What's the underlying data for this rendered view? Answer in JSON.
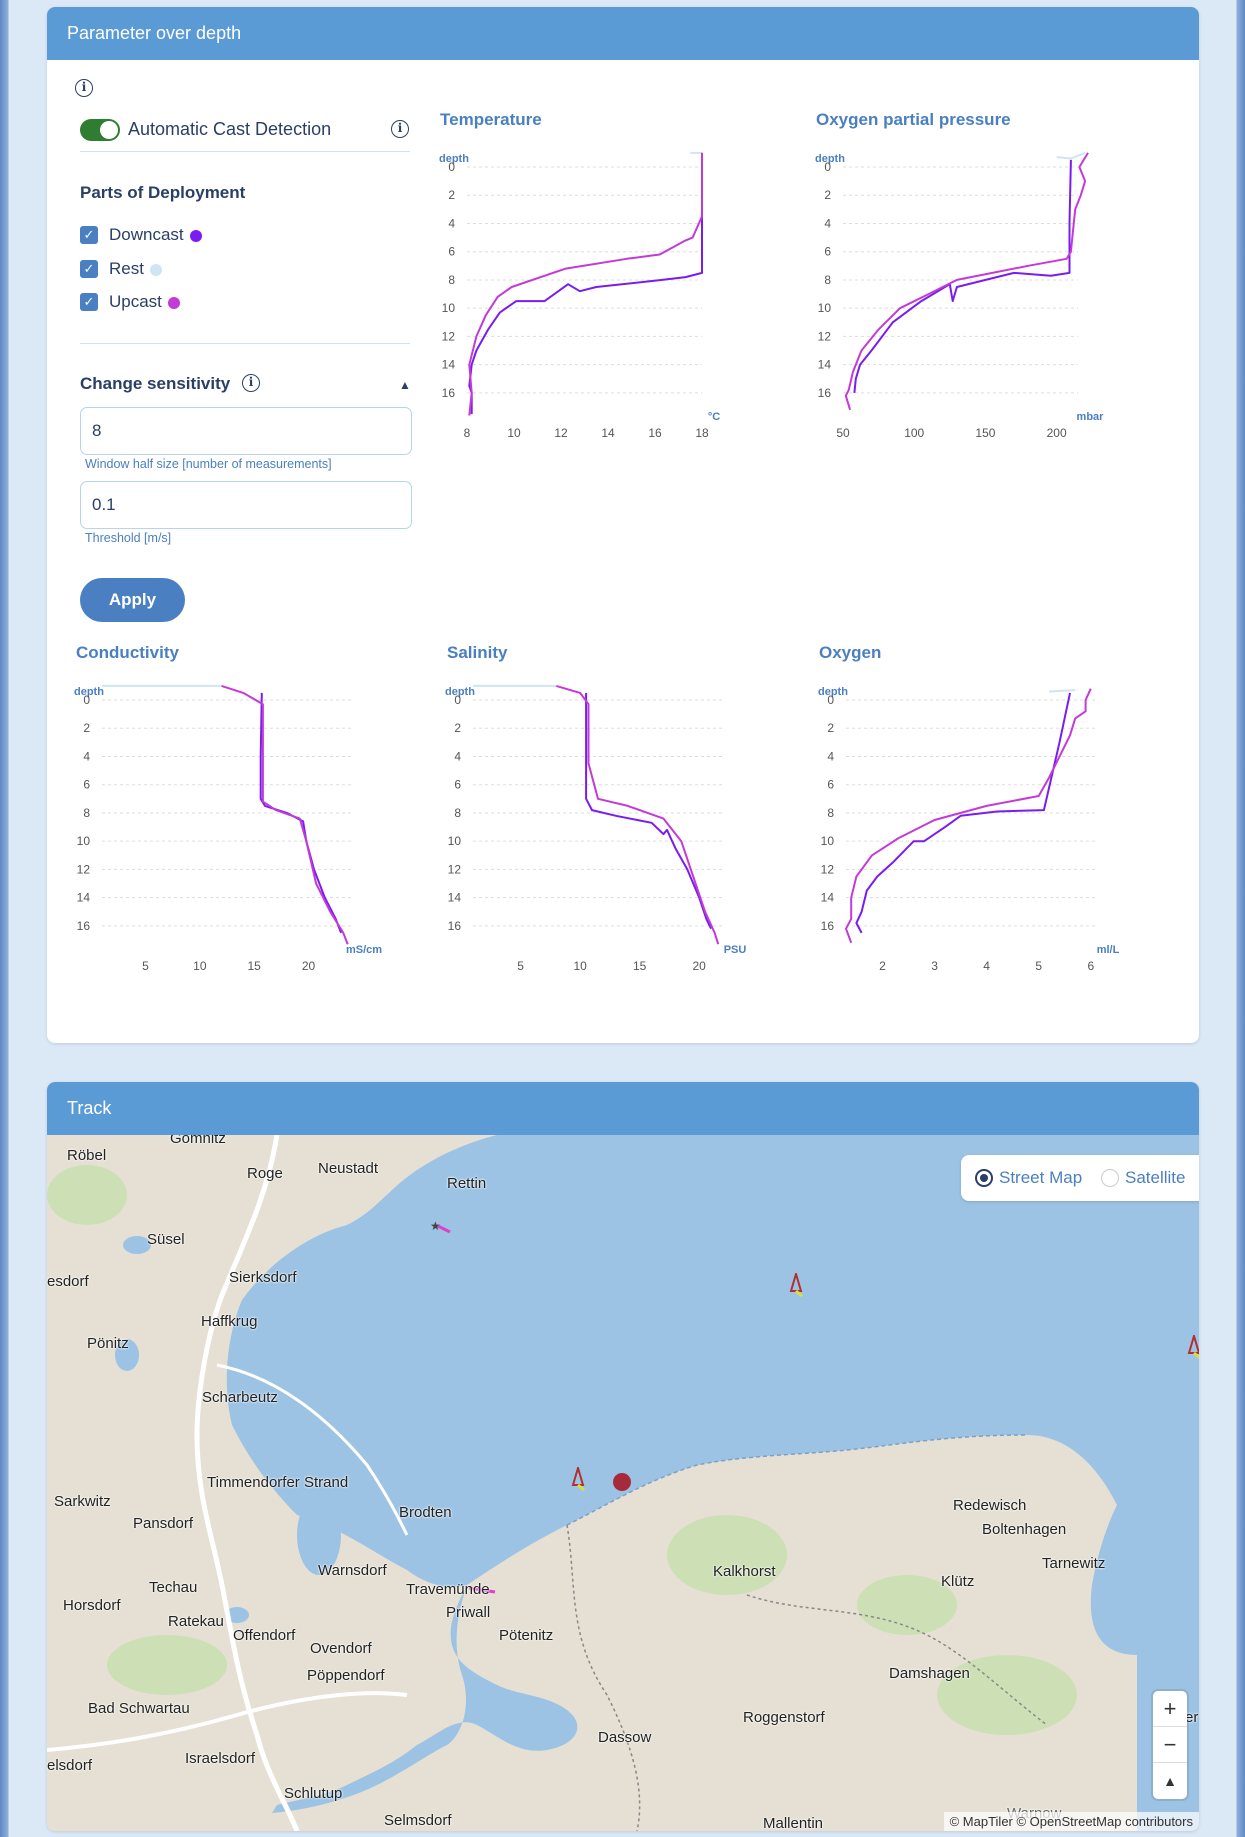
{
  "params_card": {
    "title": "Parameter over depth",
    "info_glyph": "i",
    "toggle_label": "Automatic Cast Detection",
    "toggle_on": true,
    "parts_title": "Parts of Deployment",
    "parts": [
      {
        "label": "Downcast",
        "checked": true,
        "color": "#7a1cf0"
      },
      {
        "label": "Rest",
        "checked": true,
        "color": "#cfe5f4"
      },
      {
        "label": "Upcast",
        "checked": true,
        "color": "#c33ad8"
      }
    ],
    "sensitivity_title": "Change sensitivity",
    "window_value": "8",
    "window_hint": "Window half size [number of measurements]",
    "threshold_value": "0.1",
    "threshold_hint": "Threshold [m/s]",
    "apply_label": "Apply"
  },
  "chart_data": [
    {
      "id": "temperature",
      "type": "line",
      "title": "Temperature",
      "ylabel": "depth",
      "xlabel": "°C",
      "xlim": [
        8,
        18
      ],
      "ylim": [
        0,
        17
      ],
      "xticks": [
        8,
        10,
        12,
        14,
        16,
        18
      ],
      "yticks": [
        0,
        2,
        4,
        6,
        8,
        10,
        12,
        14,
        16
      ],
      "y_inverted": true,
      "grid": true,
      "series": [
        {
          "part": "Rest",
          "color": "#cfe5f4",
          "points": [
            [
              17.5,
              -1
            ],
            [
              18,
              -1
            ]
          ]
        },
        {
          "part": "Downcast",
          "color": "#7a1cf0",
          "points": [
            [
              18,
              -1
            ],
            [
              18,
              2
            ],
            [
              18,
              7.5
            ],
            [
              17.3,
              7.8
            ],
            [
              16.3,
              8
            ],
            [
              13.5,
              8.5
            ],
            [
              12.8,
              8.8
            ],
            [
              12.3,
              8.3
            ],
            [
              11.3,
              9.5
            ],
            [
              10.1,
              9.5
            ],
            [
              9.4,
              10.3
            ],
            [
              8.9,
              11.5
            ],
            [
              8.4,
              13
            ],
            [
              8.2,
              14
            ],
            [
              8.1,
              15.5
            ],
            [
              8.2,
              16
            ],
            [
              8.2,
              17.5
            ]
          ]
        },
        {
          "part": "Upcast",
          "color": "#c33ad8",
          "points": [
            [
              18,
              -1
            ],
            [
              18,
              3.5
            ],
            [
              17.6,
              5
            ],
            [
              17.3,
              5.2
            ],
            [
              16.2,
              6.2
            ],
            [
              14.8,
              6.5
            ],
            [
              12.2,
              7.2
            ],
            [
              9.9,
              8.5
            ],
            [
              9.3,
              9.2
            ],
            [
              8.8,
              10.5
            ],
            [
              8.4,
              12
            ],
            [
              8.1,
              14
            ],
            [
              8.2,
              16
            ],
            [
              8.1,
              17.6
            ]
          ]
        }
      ]
    },
    {
      "id": "oxygen-partial-pressure",
      "type": "line",
      "title": "Oxygen partial pressure",
      "ylabel": "depth",
      "xlabel": "mbar",
      "xlim": [
        50,
        215
      ],
      "ylim": [
        0,
        17
      ],
      "xticks": [
        50,
        100,
        150,
        200
      ],
      "yticks": [
        0,
        2,
        4,
        6,
        8,
        10,
        12,
        14,
        16
      ],
      "y_inverted": true,
      "grid": true,
      "series": [
        {
          "part": "Rest",
          "color": "#cfe5f4",
          "points": [
            [
              200,
              -0.7
            ],
            [
              210,
              -0.6
            ],
            [
              220,
              -1
            ]
          ]
        },
        {
          "part": "Downcast",
          "color": "#7a1cf0",
          "points": [
            [
              210,
              -0.5
            ],
            [
              209,
              4
            ],
            [
              209,
              7.5
            ],
            [
              196,
              7.7
            ],
            [
              170,
              7.5
            ],
            [
              130,
              8.5
            ],
            [
              127,
              9.5
            ],
            [
              125,
              8.3
            ],
            [
              105,
              9.5
            ],
            [
              85,
              11
            ],
            [
              70,
              13
            ],
            [
              62,
              14
            ],
            [
              59,
              15
            ],
            [
              58,
              16
            ]
          ]
        },
        {
          "part": "Upcast",
          "color": "#c33ad8",
          "points": [
            [
              222,
              -1
            ],
            [
              216,
              0
            ],
            [
              220,
              1
            ],
            [
              217,
              2
            ],
            [
              213,
              3
            ],
            [
              211,
              5
            ],
            [
              210,
              6
            ],
            [
              207,
              6.5
            ],
            [
              180,
              7
            ],
            [
              130,
              8
            ],
            [
              110,
              9
            ],
            [
              90,
              10
            ],
            [
              75,
              11.5
            ],
            [
              63,
              13
            ],
            [
              57,
              14.5
            ],
            [
              54,
              15.8
            ],
            [
              52,
              16.2
            ],
            [
              55,
              17.2
            ]
          ]
        }
      ]
    },
    {
      "id": "conductivity",
      "type": "line",
      "title": "Conductivity",
      "ylabel": "depth",
      "xlabel": "mS/cm",
      "xlim": [
        1,
        24
      ],
      "ylim": [
        0,
        17
      ],
      "xticks": [
        5,
        10,
        15,
        20
      ],
      "yticks": [
        0,
        2,
        4,
        6,
        8,
        10,
        12,
        14,
        16
      ],
      "y_inverted": true,
      "grid": true,
      "series": [
        {
          "part": "Rest",
          "color": "#cfe5f4",
          "points": [
            [
              1,
              -1
            ],
            [
              12,
              -1
            ]
          ]
        },
        {
          "part": "Downcast",
          "color": "#7a1cf0",
          "points": [
            [
              15.7,
              -0.5
            ],
            [
              15.6,
              4
            ],
            [
              15.6,
              7
            ],
            [
              16,
              7.5
            ],
            [
              18,
              8
            ],
            [
              19.5,
              8.6
            ],
            [
              19.8,
              10
            ],
            [
              20.5,
              12
            ],
            [
              21.5,
              14
            ],
            [
              22.5,
              15.5
            ],
            [
              23,
              16.5
            ]
          ]
        },
        {
          "part": "Upcast",
          "color": "#c33ad8",
          "points": [
            [
              12,
              -1
            ],
            [
              14,
              -0.5
            ],
            [
              15.8,
              0.3
            ],
            [
              15.8,
              4
            ],
            [
              15.8,
              7.2
            ],
            [
              17,
              7.8
            ],
            [
              19.2,
              8.4
            ],
            [
              19.8,
              10
            ],
            [
              20.7,
              13
            ],
            [
              22,
              15
            ],
            [
              23.2,
              16.5
            ],
            [
              23.6,
              17.3
            ]
          ]
        }
      ]
    },
    {
      "id": "salinity",
      "type": "line",
      "title": "Salinity",
      "ylabel": "depth",
      "xlabel": "PSU",
      "xlim": [
        1,
        22
      ],
      "ylim": [
        0,
        17
      ],
      "xticks": [
        5,
        10,
        15,
        20
      ],
      "yticks": [
        0,
        2,
        4,
        6,
        8,
        10,
        12,
        14,
        16
      ],
      "y_inverted": true,
      "grid": true,
      "series": [
        {
          "part": "Rest",
          "color": "#cfe5f4",
          "points": [
            [
              1,
              -1
            ],
            [
              8,
              -1
            ]
          ]
        },
        {
          "part": "Downcast",
          "color": "#7a1cf0",
          "points": [
            [
              10.5,
              -0.5
            ],
            [
              10.5,
              4
            ],
            [
              10.5,
              7
            ],
            [
              11,
              7.8
            ],
            [
              13,
              8.2
            ],
            [
              16,
              8.7
            ],
            [
              17,
              9.5
            ],
            [
              17.3,
              9.2
            ],
            [
              18,
              10.5
            ],
            [
              19,
              12
            ],
            [
              20,
              14
            ],
            [
              20.6,
              15.5
            ],
            [
              21,
              16.2
            ]
          ]
        },
        {
          "part": "Upcast",
          "color": "#c33ad8",
          "points": [
            [
              8,
              -1
            ],
            [
              10,
              -0.5
            ],
            [
              10.7,
              0.3
            ],
            [
              10.7,
              4.5
            ],
            [
              11.5,
              7
            ],
            [
              14,
              7.5
            ],
            [
              17,
              8.4
            ],
            [
              18.5,
              10
            ],
            [
              19.5,
              12.5
            ],
            [
              20.5,
              15
            ],
            [
              21.3,
              16.5
            ],
            [
              21.6,
              17.3
            ]
          ]
        }
      ]
    },
    {
      "id": "oxygen",
      "type": "line",
      "title": "Oxygen",
      "ylabel": "depth",
      "xlabel": "ml/L",
      "xlim": [
        1.3,
        6.1
      ],
      "ylim": [
        0,
        17
      ],
      "xticks": [
        2,
        3,
        4,
        5,
        6
      ],
      "yticks": [
        0,
        2,
        4,
        6,
        8,
        10,
        12,
        14,
        16
      ],
      "y_inverted": true,
      "grid": true,
      "series": [
        {
          "part": "Rest",
          "color": "#cfe5f4",
          "points": [
            [
              5.2,
              -0.6
            ],
            [
              5.7,
              -0.7
            ]
          ]
        },
        {
          "part": "Downcast",
          "color": "#7a1cf0",
          "points": [
            [
              5.6,
              -0.5
            ],
            [
              5.4,
              3
            ],
            [
              5.1,
              7.8
            ],
            [
              4.2,
              7.9
            ],
            [
              3.5,
              8.2
            ],
            [
              3.2,
              9
            ],
            [
              2.8,
              10
            ],
            [
              2.6,
              10
            ],
            [
              2.2,
              11.5
            ],
            [
              1.9,
              12.5
            ],
            [
              1.7,
              13.5
            ],
            [
              1.6,
              15
            ],
            [
              1.5,
              15.8
            ],
            [
              1.6,
              16.5
            ]
          ]
        },
        {
          "part": "Upcast",
          "color": "#c33ad8",
          "points": [
            [
              6,
              -0.8
            ],
            [
              5.9,
              0
            ],
            [
              5.9,
              0.8
            ],
            [
              5.7,
              1.3
            ],
            [
              5.6,
              2.5
            ],
            [
              5.2,
              5.5
            ],
            [
              5,
              6.8
            ],
            [
              4,
              7.5
            ],
            [
              3,
              8.5
            ],
            [
              2.3,
              9.8
            ],
            [
              1.8,
              11
            ],
            [
              1.5,
              12.5
            ],
            [
              1.4,
              14
            ],
            [
              1.4,
              15.5
            ],
            [
              1.3,
              16.2
            ],
            [
              1.4,
              17.2
            ]
          ]
        }
      ]
    }
  ],
  "track_card": {
    "title": "Track",
    "layers": [
      {
        "label": "Street Map",
        "selected": true
      },
      {
        "label": "Satellite",
        "selected": false
      }
    ],
    "zoom_in": "+",
    "zoom_out": "−",
    "compass": "▲",
    "attribution": "© MapTiler © OpenStreetMap contributors",
    "places": [
      "Gömnitz",
      "Röbel",
      "Roge",
      "Neustadt",
      "Rettin",
      "Süsel",
      "esdorf",
      "Sierksdorf",
      "Haffkrug",
      "Pönitz",
      "Scharbeutz",
      "Timmendorfer Strand",
      "Sarkwitz",
      "Pansdorf",
      "Brodten",
      "Warnsdorf",
      "Techau",
      "Travemünde",
      "Horsdorf",
      "Ratekau",
      "Priwall",
      "Pötenitz",
      "Offendorf",
      "Ovendorf",
      "Pöppendorf",
      "Bad Schwartau",
      "Israelsdorf",
      "elsdorf",
      "Schlutup",
      "Selmsdorf",
      "Dassow",
      "Roggenstorf",
      "Mallentin",
      "Damshagen",
      "Kalkhorst",
      "Klütz",
      "Redewisch",
      "Boltenhagen",
      "Tarnewitz",
      "Warnow",
      "er"
    ]
  }
}
